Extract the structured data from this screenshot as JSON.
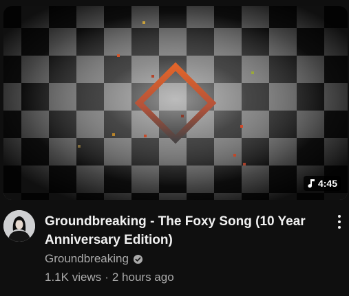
{
  "video": {
    "duration": "4:45",
    "title": "Groundbreaking - The Foxy Song (10 Year Anniversary Edition)",
    "channel": "Groundbreaking",
    "views": "1.1K views",
    "separator": "·",
    "age": "2 hours ago"
  },
  "icons": {
    "duration": "music-note-icon",
    "channel_badge": "verified-check-icon",
    "menu": "more-vertical-icon"
  },
  "colors": {
    "background": "#0f0f0f",
    "title": "#f1f1f1",
    "secondary_text": "#aaaaaa",
    "diamond_top": "#e0642a",
    "diamond_bottom": "#4a4444"
  }
}
